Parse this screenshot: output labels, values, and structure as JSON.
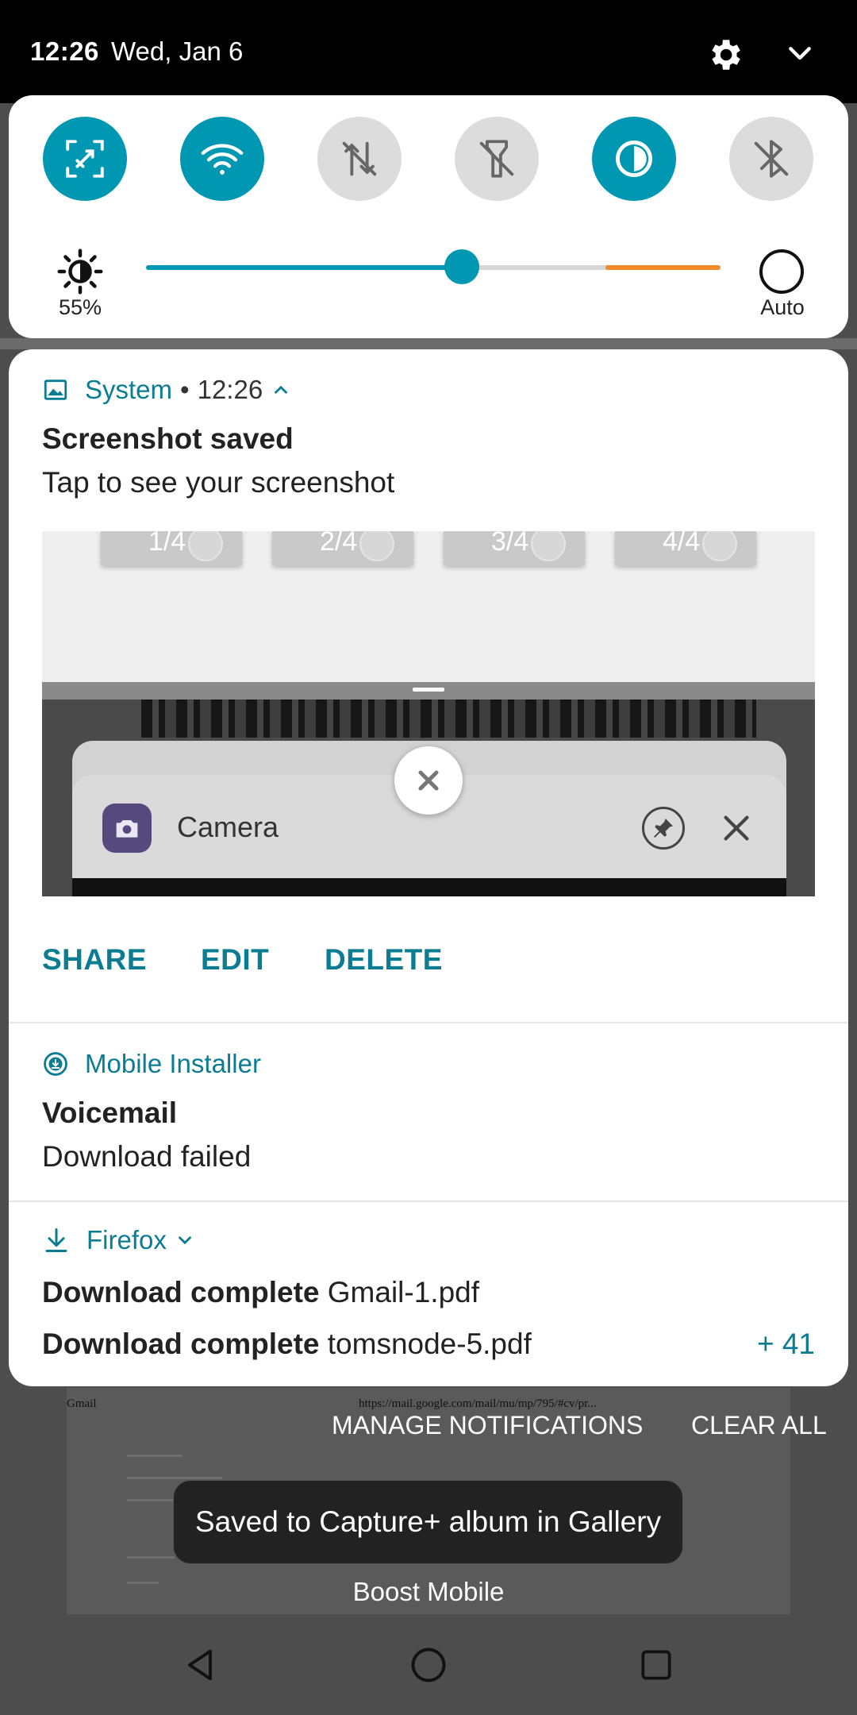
{
  "status_bar": {
    "time": "12:26",
    "date": "Wed, Jan 6",
    "icons": [
      "settings-icon",
      "chevron-down-icon"
    ]
  },
  "quick_settings": {
    "tiles": [
      {
        "name": "screen-capture",
        "icon": "capture-icon",
        "state": "on"
      },
      {
        "name": "wifi",
        "icon": "wifi-icon",
        "state": "on"
      },
      {
        "name": "mobile-data",
        "icon": "data-transfer-off-icon",
        "state": "off"
      },
      {
        "name": "flashlight",
        "icon": "flashlight-off-icon",
        "state": "off"
      },
      {
        "name": "invert-colors",
        "icon": "contrast-icon",
        "state": "on"
      },
      {
        "name": "bluetooth",
        "icon": "bluetooth-off-icon",
        "state": "off"
      }
    ],
    "brightness": {
      "value_label": "55%",
      "level": 0.55,
      "auto_label": "Auto"
    }
  },
  "notifications": [
    {
      "app": "System",
      "time": "12:26",
      "icon": "image-icon",
      "title": "Screenshot saved",
      "text": "Tap to see your screenshot",
      "preview": {
        "cards": [
          "1/4",
          "2/4",
          "3/4",
          "4/4"
        ],
        "recent_app_label": "Camera"
      },
      "actions": [
        "SHARE",
        "EDIT",
        "DELETE"
      ]
    },
    {
      "app": "Mobile Installer",
      "icon": "download-circle-icon",
      "title": "Voicemail",
      "text": "Download failed"
    },
    {
      "app": "Firefox",
      "icon": "download-icon",
      "lines": [
        {
          "bold": "Download complete",
          "text": "Gmail-1.pdf"
        },
        {
          "bold": "Download complete",
          "text": "tomsnode-5.pdf"
        }
      ],
      "more_count": "+ 41"
    }
  ],
  "background": {
    "page_title": "Gmail",
    "page_url": "https://mail.google.com/mail/mu/mp/795/#cv/pr..."
  },
  "footer": {
    "manage": "MANAGE NOTIFICATIONS",
    "clear_all": "CLEAR ALL",
    "toast": "Saved to Capture+ album in Gallery",
    "carrier": "Boost Mobile"
  },
  "nav_bar": {
    "buttons": [
      "back-icon",
      "home-icon",
      "recents-icon"
    ]
  },
  "colors": {
    "accent": "#0097b2",
    "link": "#0a7d92",
    "warm": "#f18b2a"
  }
}
